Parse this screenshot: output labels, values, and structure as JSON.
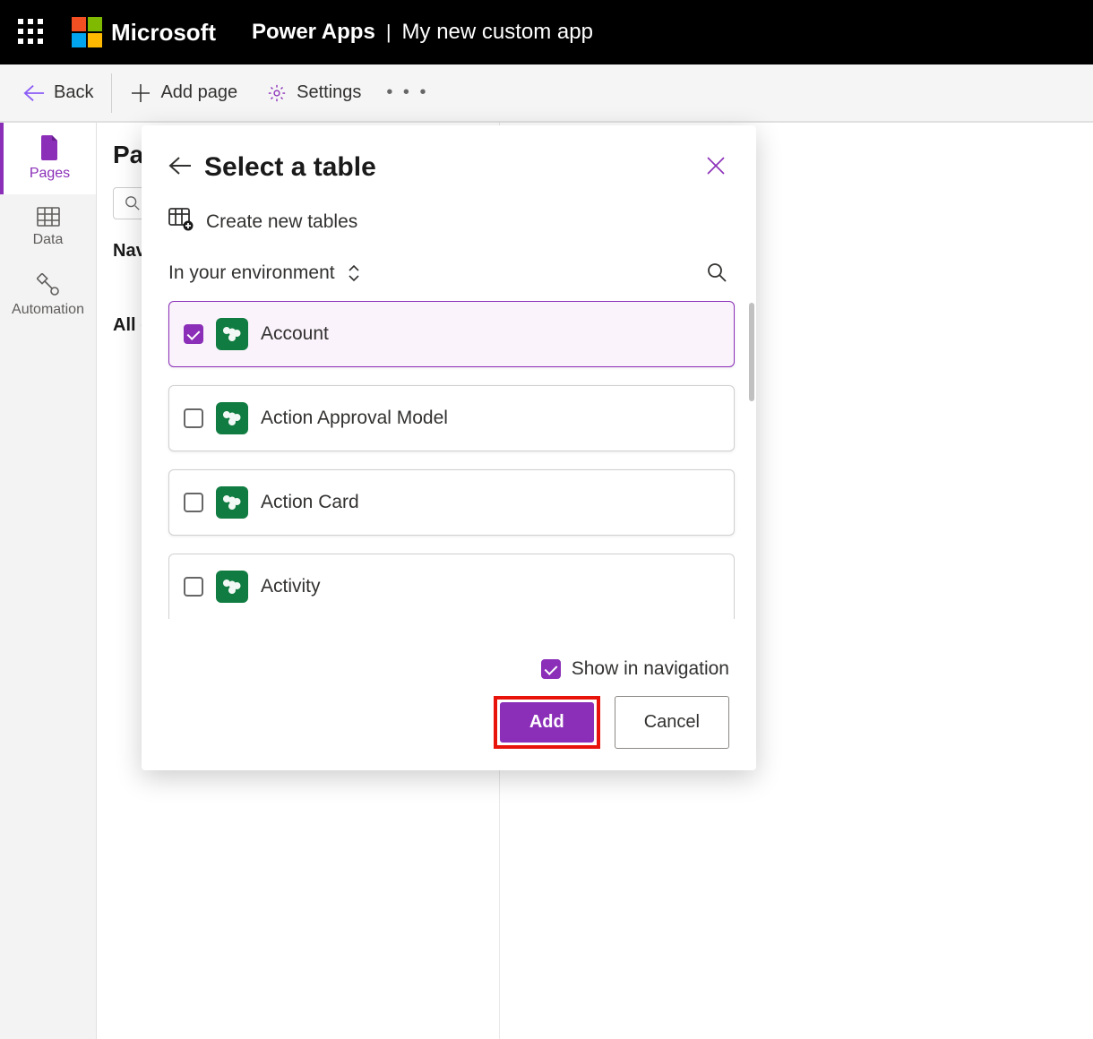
{
  "header": {
    "brand": "Microsoft",
    "app_name": "Power Apps",
    "app_subtitle": "My new custom app"
  },
  "toolbar": {
    "back_label": "Back",
    "add_page_label": "Add page",
    "settings_label": "Settings"
  },
  "left_rail": {
    "items": [
      {
        "label": "Pages"
      },
      {
        "label": "Data"
      },
      {
        "label": "Automation"
      }
    ]
  },
  "content": {
    "title": "Pages",
    "nav_heading": "Navigation",
    "all_heading": "All other pages"
  },
  "modal": {
    "title": "Select a table",
    "create_new_label": "Create new tables",
    "env_label": "In your environment",
    "tables": [
      {
        "name": "Account",
        "selected": true
      },
      {
        "name": "Action Approval Model",
        "selected": false
      },
      {
        "name": "Action Card",
        "selected": false
      },
      {
        "name": "Activity",
        "selected": false
      }
    ],
    "show_in_nav_label": "Show in navigation",
    "show_in_nav_checked": true,
    "add_button": "Add",
    "cancel_button": "Cancel"
  }
}
